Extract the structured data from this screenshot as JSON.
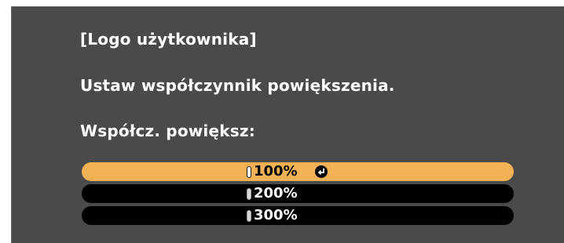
{
  "dialog": {
    "title": "[Logo użytkownika]",
    "instruction": "Ustaw współczynnik powiększenia.",
    "field_label": "Współcz. powiększ:"
  },
  "zoom_options": [
    {
      "label": "100%",
      "selected": true,
      "icon": "enter-icon"
    },
    {
      "label": "200%",
      "selected": false
    },
    {
      "label": "300%",
      "selected": false
    }
  ],
  "colors": {
    "panel_background": "#4a4a4a",
    "selected_highlight": "#f2b155",
    "option_background": "#000000",
    "text": "#ffffff"
  }
}
